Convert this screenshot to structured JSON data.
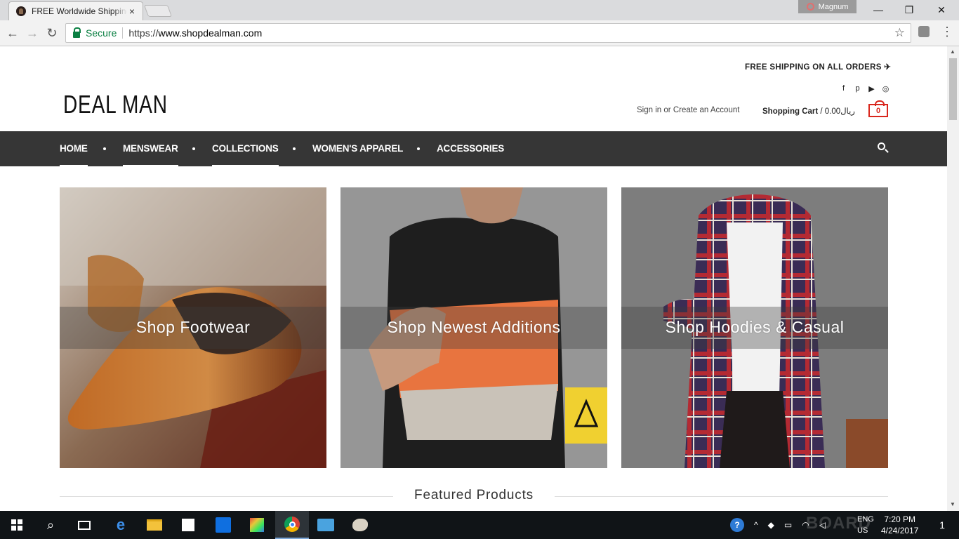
{
  "browser": {
    "tab_title": "FREE Worldwide Shipping",
    "tab_close": "×",
    "profile_name": "Magnum",
    "win_minimize": "—",
    "win_restore": "❐",
    "win_close": "✕",
    "secure_label": "Secure",
    "url_scheme": "https://",
    "url_host": "www.shopdealman.com",
    "back_icon": "arrow-left",
    "forward_icon": "arrow-right",
    "reload_icon": "reload",
    "bookmark_icon": "star"
  },
  "header": {
    "shipping_notice": "FREE SHIPPING ON ALL ORDERS ✈",
    "social": [
      "f",
      "p",
      "▶",
      "◎"
    ],
    "logo": "DEAL MAN",
    "sign_in": "Sign in",
    "or_text": "or",
    "create_account": "Create an Account",
    "cart_label": "Shopping Cart",
    "cart_total": "/ 0.00ريال",
    "cart_count": "0",
    "accent_color": "#d9261c"
  },
  "nav": {
    "items": [
      "HOME",
      "MENSWEAR",
      "COLLECTIONS",
      "WOMEN'S APPAREL",
      "ACCESSORIES"
    ],
    "bar_color": "#363636"
  },
  "promos": [
    {
      "label": "Shop Footwear"
    },
    {
      "label": "Shop Newest Additions"
    },
    {
      "label": "Shop Hoodies & Casual"
    }
  ],
  "featured_heading": "Featured Products",
  "taskbar": {
    "lang_top": "ENG",
    "lang_bottom": "US",
    "time": "7:20 PM",
    "date": "4/24/2017",
    "notifications": "1"
  }
}
